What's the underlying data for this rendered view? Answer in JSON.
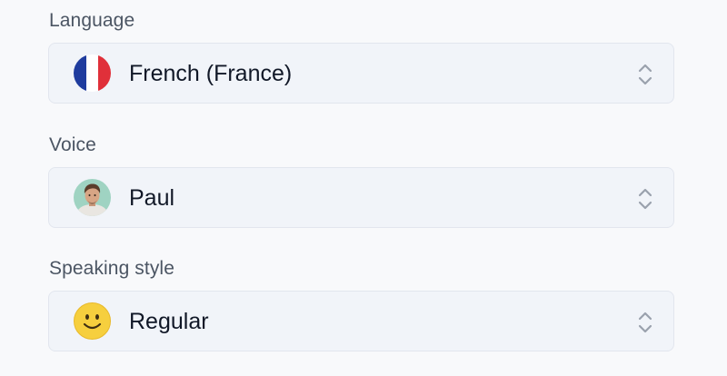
{
  "colors": {
    "background": "#f8f9fb",
    "select_background": "#f1f4f9",
    "select_border": "#e2e6ee",
    "label_text": "#4b5563",
    "value_text": "#111827",
    "chevron": "#9aa1ad",
    "flag_blue": "#1f3c9e",
    "flag_white": "#ffffff",
    "flag_red": "#e0303a",
    "smiley_yellow": "#f6cf3e"
  },
  "fields": {
    "language": {
      "label": "Language",
      "value": "French (France)",
      "icon": "france-flag-icon"
    },
    "voice": {
      "label": "Voice",
      "value": "Paul",
      "icon": "avatar-icon"
    },
    "speaking_style": {
      "label": "Speaking style",
      "value": "Regular",
      "icon": "smiley-face-icon"
    }
  }
}
